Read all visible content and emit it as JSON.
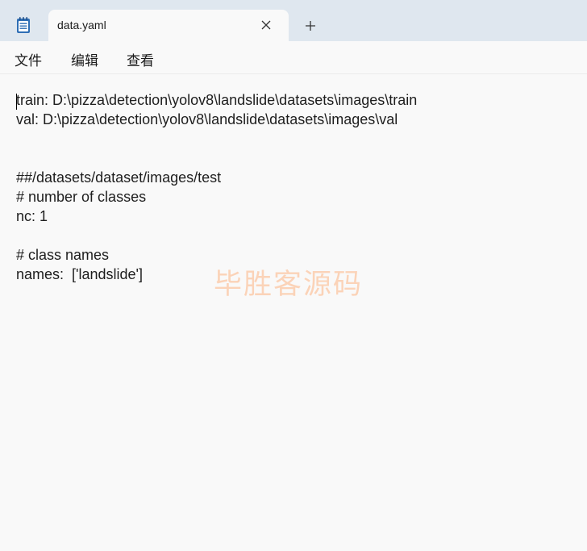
{
  "tab": {
    "title": "data.yaml"
  },
  "menu": {
    "file": "文件",
    "edit": "编辑",
    "view": "查看"
  },
  "editor": {
    "lines": [
      "train: D:\\pizza\\detection\\yolov8\\landslide\\datasets\\images\\train",
      "val: D:\\pizza\\detection\\yolov8\\landslide\\datasets\\images\\val",
      "",
      "",
      "##/datasets/dataset/images/test",
      "# number of classes",
      "nc: 1",
      "",
      "# class names",
      "names:  ['landslide']"
    ]
  },
  "watermark": "毕胜客源码",
  "icons": {
    "app": "notepad-icon",
    "close": "close-icon",
    "new_tab": "plus-icon"
  },
  "colors": {
    "titlebar": "#dfe7ef",
    "background": "#f9f9f9",
    "text": "#1e1e1e",
    "watermark": "#fbd3b8",
    "notepad_blue": "#2f6fb5"
  }
}
